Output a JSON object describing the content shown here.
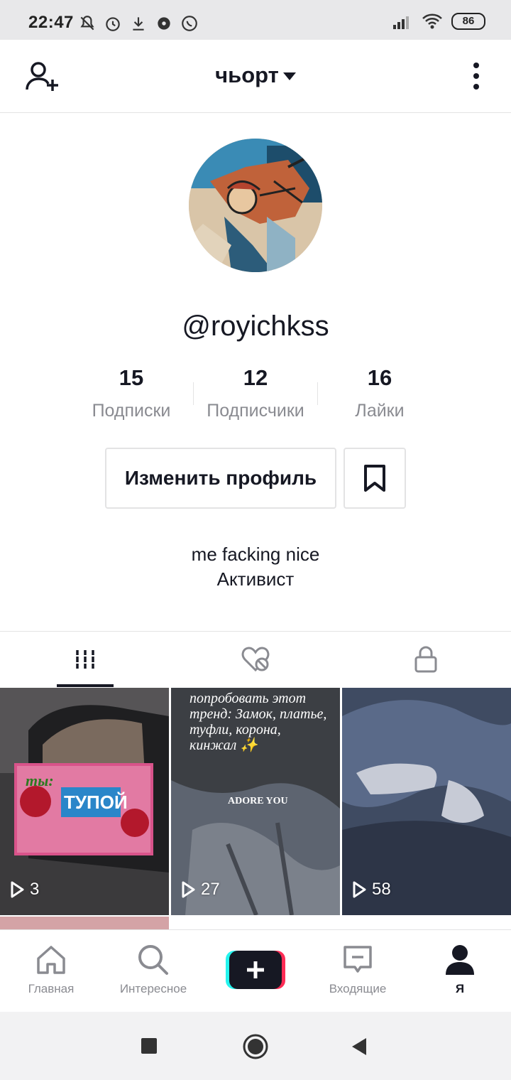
{
  "status_bar": {
    "time": "22:47",
    "battery": "86"
  },
  "header": {
    "title": "чьорт"
  },
  "profile": {
    "username": "@royichkss",
    "stats": [
      {
        "value": "15",
        "label": "Подписки"
      },
      {
        "value": "12",
        "label": "Подписчики"
      },
      {
        "value": "16",
        "label": "Лайки"
      }
    ],
    "edit_button": "Изменить профиль",
    "bio_line1": "me facking nice",
    "bio_line2": "Активист"
  },
  "videos": [
    {
      "views": "3",
      "caption_top": "ты:",
      "caption_mid": "ТУПОЙ"
    },
    {
      "views": "27",
      "caption": "попробовать этот тренд: Замок, платье, туфли, корона, кинжал ✨",
      "caption_small": "ADORE YOU"
    },
    {
      "views": "58"
    }
  ],
  "bottom_nav": [
    {
      "label": "Главная",
      "icon": "home-icon"
    },
    {
      "label": "Интересное",
      "icon": "search-icon"
    },
    {
      "label": "",
      "icon": "plus-icon"
    },
    {
      "label": "Входящие",
      "icon": "inbox-icon"
    },
    {
      "label": "Я",
      "icon": "profile-icon"
    }
  ],
  "colors": {
    "accent_red": "#fe2c55",
    "accent_cyan": "#25f4ee",
    "text": "#161823",
    "muted": "#8a8b91"
  }
}
